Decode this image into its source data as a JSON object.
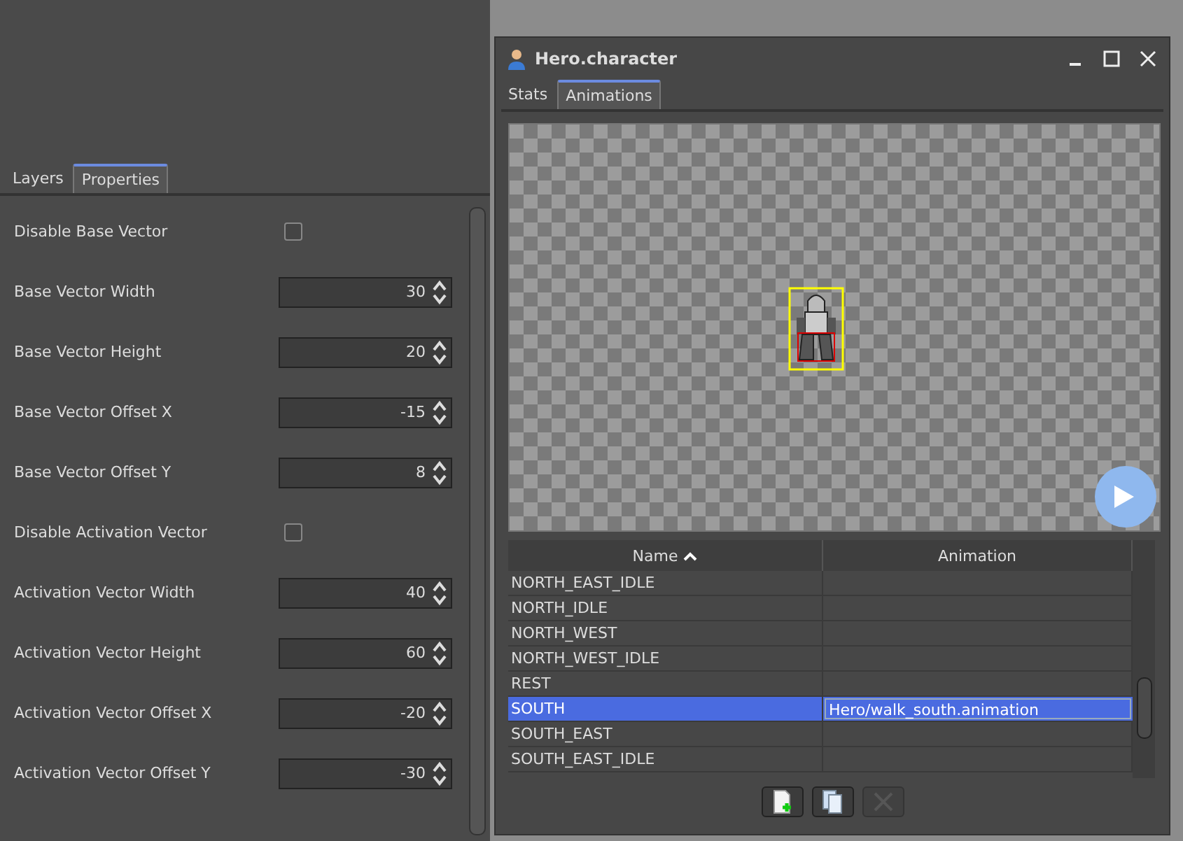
{
  "left_panel": {
    "tabs": [
      {
        "label": "Layers",
        "selected": false
      },
      {
        "label": "Properties",
        "selected": true
      }
    ],
    "properties": [
      {
        "kind": "checkbox",
        "label": "Disable Base Vector",
        "checked": false
      },
      {
        "kind": "spinner",
        "label": "Base Vector Width",
        "value": "30"
      },
      {
        "kind": "spinner",
        "label": "Base Vector Height",
        "value": "20"
      },
      {
        "kind": "spinner",
        "label": "Base Vector Offset X",
        "value": "-15"
      },
      {
        "kind": "spinner",
        "label": "Base Vector Offset Y",
        "value": "8"
      },
      {
        "kind": "checkbox",
        "label": "Disable Activation Vector",
        "checked": false
      },
      {
        "kind": "spinner",
        "label": "Activation Vector Width",
        "value": "40"
      },
      {
        "kind": "spinner",
        "label": "Activation Vector Height",
        "value": "60"
      },
      {
        "kind": "spinner",
        "label": "Activation Vector Offset X",
        "value": "-20"
      },
      {
        "kind": "spinner",
        "label": "Activation Vector Offset Y",
        "value": "-30"
      }
    ]
  },
  "window": {
    "title": "Hero.character",
    "tabs": [
      {
        "label": "Stats",
        "selected": false
      },
      {
        "label": "Animations",
        "selected": true
      }
    ],
    "table": {
      "columns": [
        "Name",
        "Animation"
      ],
      "rows": [
        {
          "name": "NORTH_EAST_IDLE",
          "animation": "",
          "selected": false
        },
        {
          "name": "NORTH_IDLE",
          "animation": "",
          "selected": false
        },
        {
          "name": "NORTH_WEST",
          "animation": "",
          "selected": false
        },
        {
          "name": "NORTH_WEST_IDLE",
          "animation": "",
          "selected": false
        },
        {
          "name": "REST",
          "animation": "",
          "selected": false
        },
        {
          "name": "SOUTH",
          "animation": "Hero/walk_south.animation",
          "selected": true
        },
        {
          "name": "SOUTH_EAST",
          "animation": "",
          "selected": false
        },
        {
          "name": "SOUTH_EAST_IDLE",
          "animation": "",
          "selected": false
        }
      ]
    },
    "buttons": [
      {
        "kind": "add",
        "disabled": false
      },
      {
        "kind": "copy",
        "disabled": false
      },
      {
        "kind": "remove",
        "disabled": true
      }
    ]
  }
}
